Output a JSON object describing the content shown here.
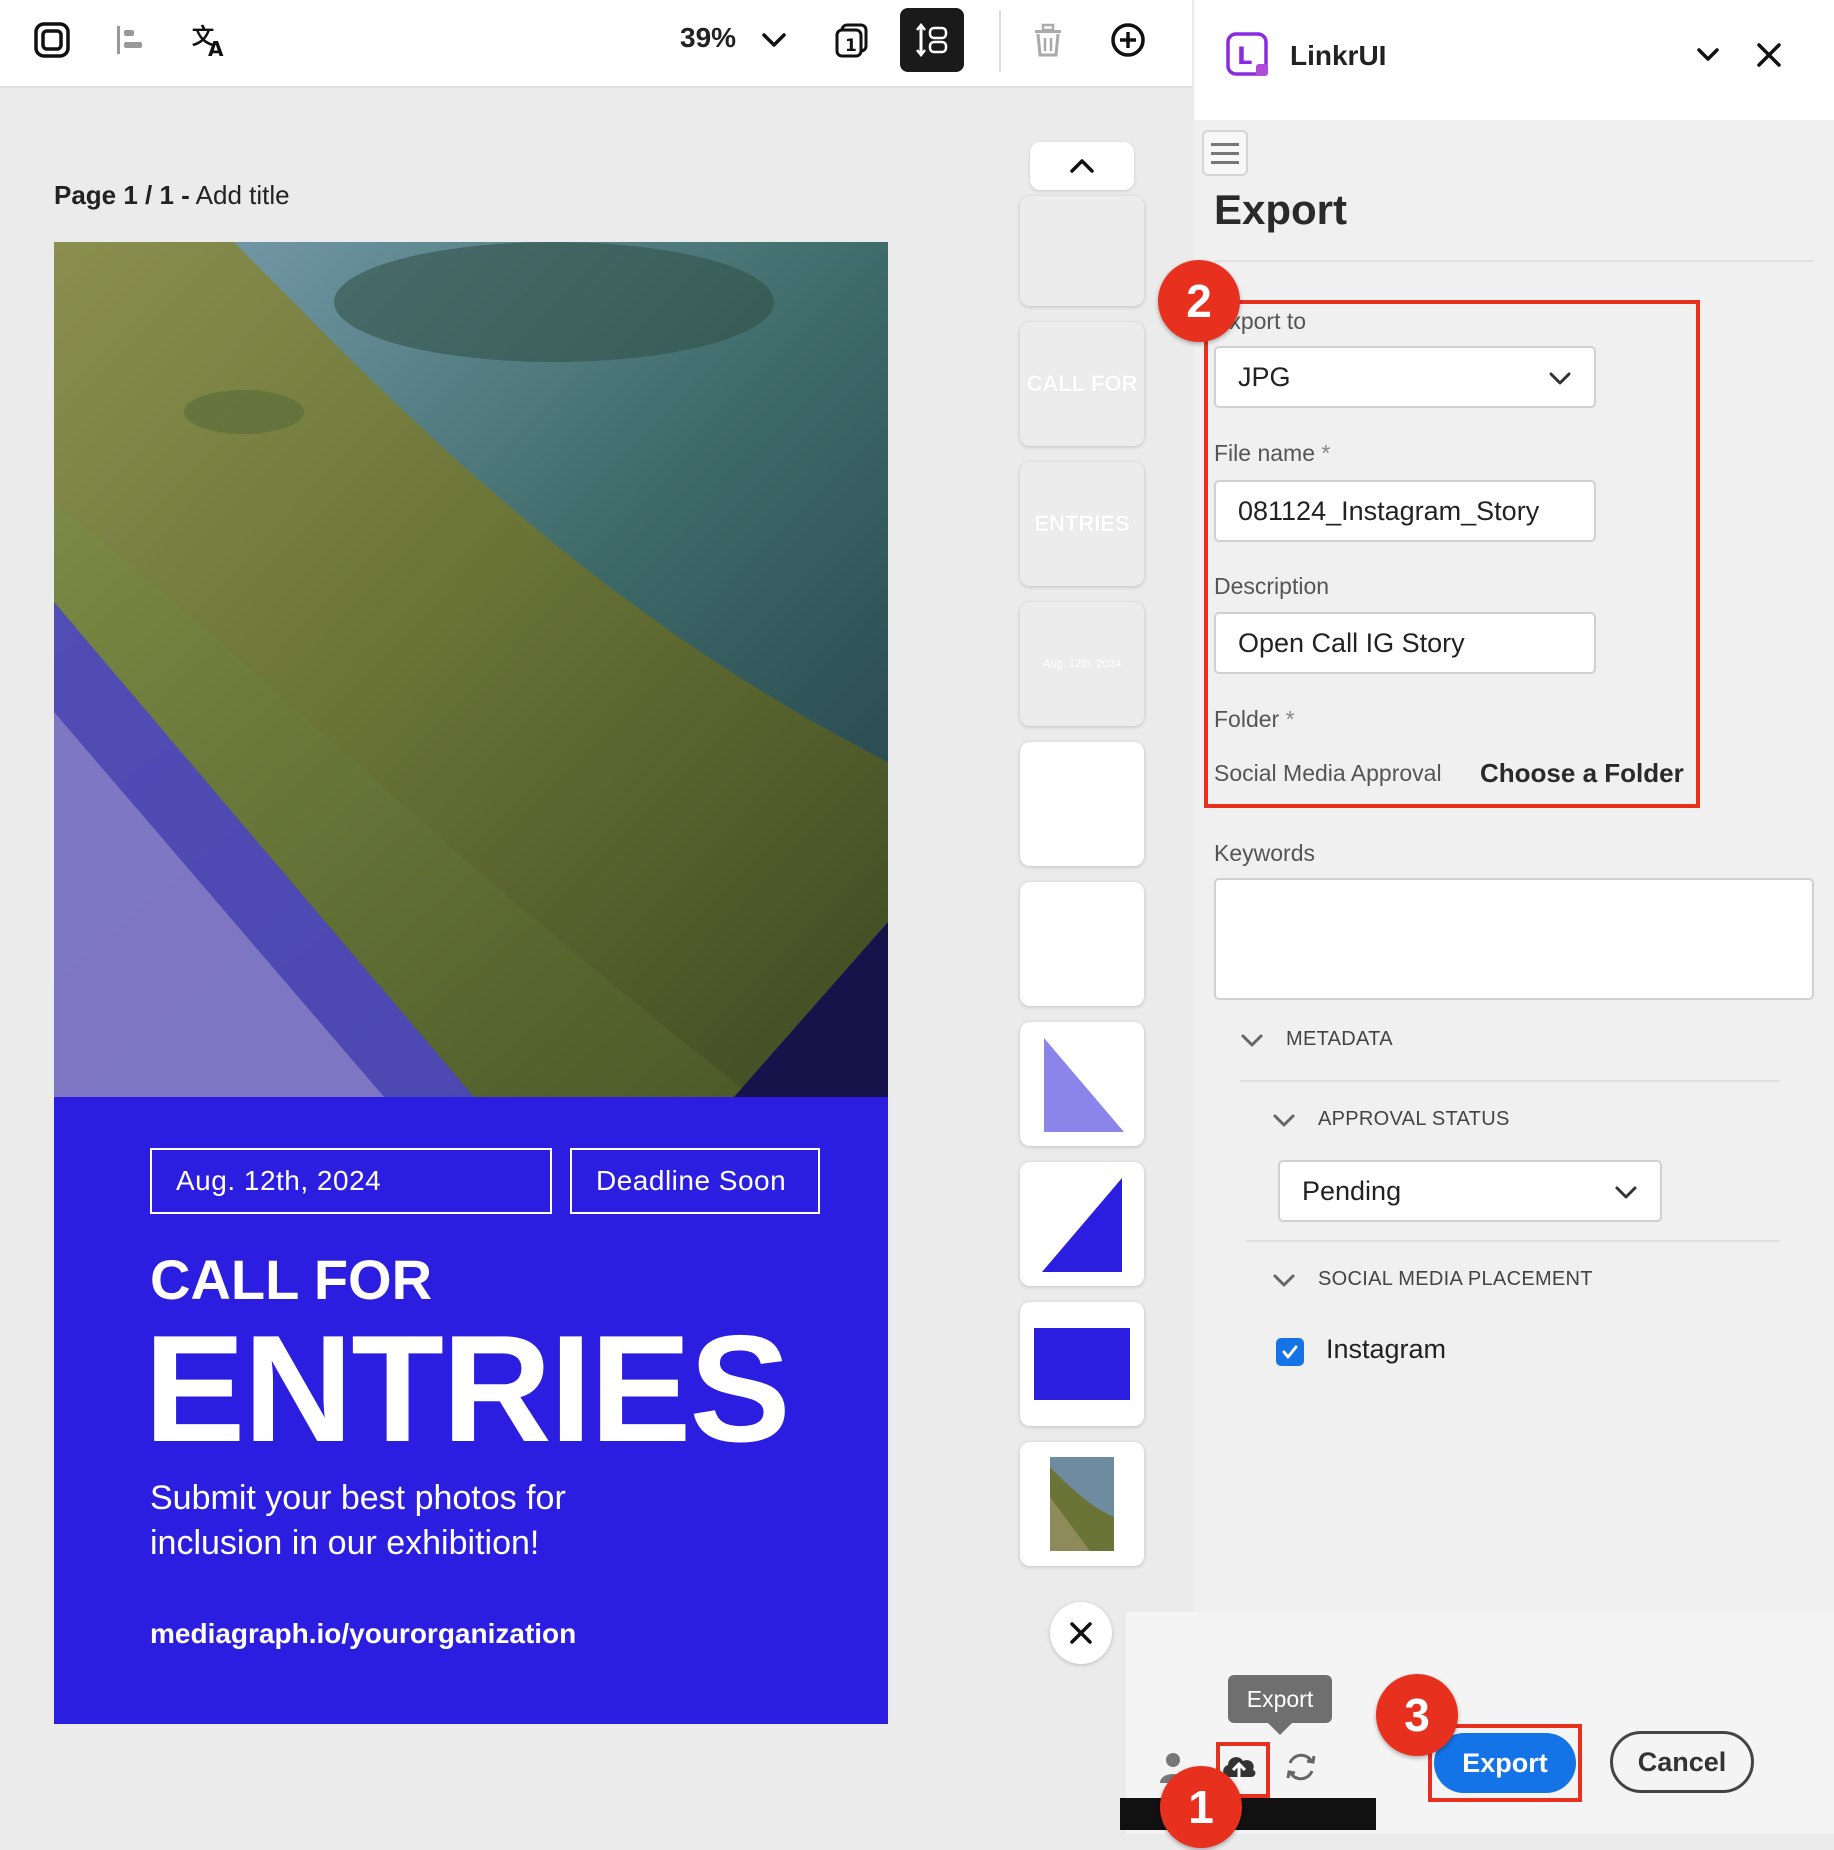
{
  "toolbar": {
    "zoom": "39%",
    "icons": [
      "instagram-icon",
      "align-left-icon",
      "translate-icon",
      "chevron-down-icon",
      "page-count-icon",
      "vertical-resize-icon",
      "trash-icon",
      "add-circle-icon"
    ]
  },
  "canvas": {
    "page_prefix": "Page 1 / 1 -",
    "page_title": "Add title"
  },
  "poster": {
    "date": "Aug. 12th, 2024",
    "deadline": "Deadline Soon",
    "call_for": "CALL FOR",
    "entries": "ENTRIES",
    "subtitle": "Submit your best photos for inclusion in our exhibition!",
    "url": "mediagraph.io/yourorganization",
    "background_color": "#2c1ee0"
  },
  "layers": {
    "thumb_call_for": "CALL FOR",
    "thumb_entries": "ENTRIES",
    "thumb_date": "Aug. 12th, 2024"
  },
  "panel": {
    "app_name": "LinkrUI",
    "heading": "Export",
    "export_to_label": "Export to",
    "export_to_value": "JPG",
    "file_name_label": "File name",
    "file_name_value": "081124_Instagram_Story",
    "description_label": "Description",
    "description_value": "Open Call IG Story",
    "folder_label": "Folder",
    "required_mark": "*",
    "folder_value": "Social Media Approval",
    "choose_folder": "Choose a Folder",
    "keywords_label": "Keywords",
    "keywords_value": "",
    "metadata_label": "METADATA",
    "approval_status_label": "APPROVAL STATUS",
    "approval_status_value": "Pending",
    "placement_label": "SOCIAL MEDIA PLACEMENT",
    "placement_option": "Instagram",
    "placement_checked": true
  },
  "footer": {
    "tooltip": "Export",
    "export_button": "Export",
    "cancel_button": "Cancel"
  },
  "annotations": {
    "step1": "1",
    "step2": "2",
    "step3": "3",
    "color": "#e8301f"
  },
  "colors": {
    "accent": "#1473e6",
    "brand_purple": "#8a2be2"
  }
}
